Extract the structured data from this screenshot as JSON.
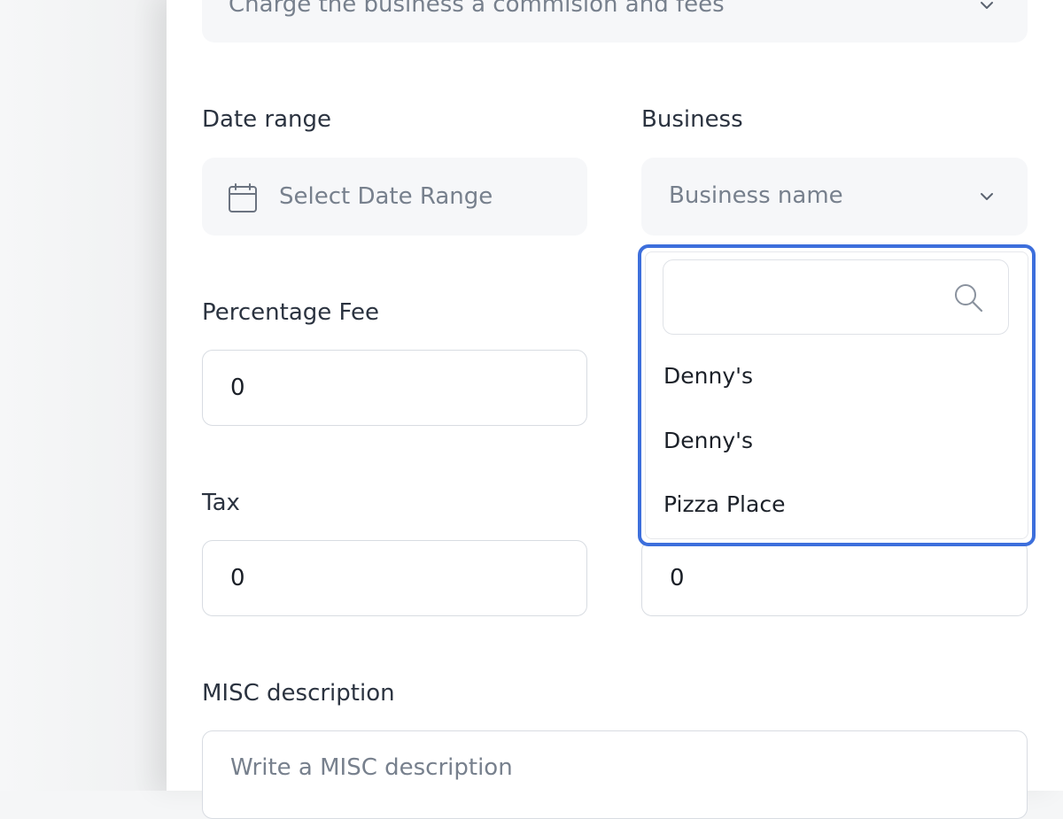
{
  "top_select": {
    "value": "Charge the business a commision and fees"
  },
  "date_range": {
    "label": "Date range",
    "placeholder": "Select Date Range"
  },
  "business": {
    "label": "Business",
    "placeholder": "Business name",
    "search_placeholder": "",
    "options": [
      "Denny's",
      "Denny's",
      "Pizza Place"
    ]
  },
  "percentage_fee": {
    "label": "Percentage Fee",
    "value": "0"
  },
  "tax": {
    "label": "Tax",
    "value": "0"
  },
  "right_field": {
    "value": "0"
  },
  "misc": {
    "label": "MISC description",
    "placeholder": "Write a MISC description"
  },
  "colors": {
    "accent": "#3d6fdc",
    "field_bg": "#f6f7f9",
    "border": "#d8dce2"
  }
}
